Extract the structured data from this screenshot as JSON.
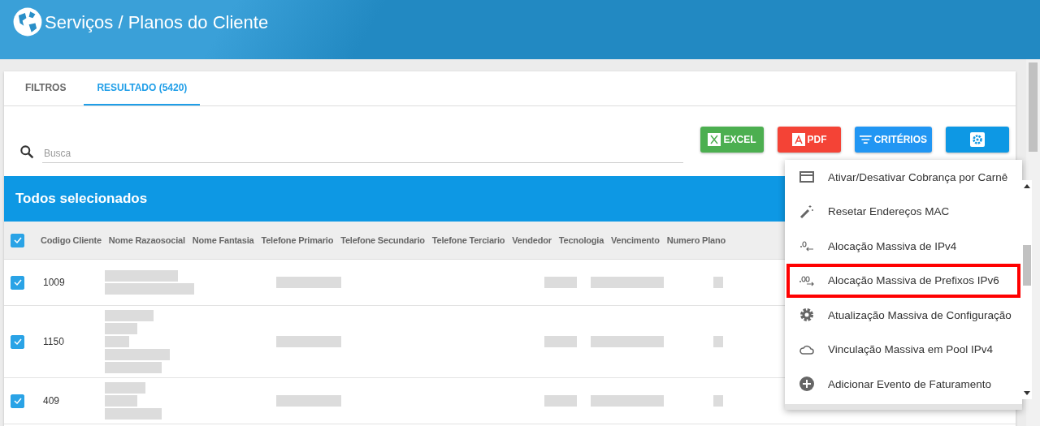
{
  "header": {
    "title": "Serviços / Planos do Cliente"
  },
  "tabs": [
    {
      "label": "FILTROS",
      "selected": false
    },
    {
      "label": "RESULTADO (5420)",
      "selected": true
    }
  ],
  "search": {
    "placeholder": "Busca"
  },
  "buttons": [
    {
      "kind": "excel",
      "label": "EXCEL"
    },
    {
      "kind": "pdf",
      "label": "PDF"
    },
    {
      "kind": "criteria",
      "label": "CRITÉRIOS"
    },
    {
      "kind": "settings"
    }
  ],
  "selection_bar": {
    "title": "Todos selecionados"
  },
  "table": {
    "all_checked": true,
    "columns": [
      "Codigo Cliente",
      "Nome Razaosocial",
      "Nome Fantasia",
      "Telefone Primario",
      "Telefone Secundario",
      "Telefone Terciario",
      "Vendedor",
      "Tecnologia",
      "Vencimento",
      "Numero Plano"
    ],
    "rows": [
      {
        "checked": true,
        "code": "1009"
      },
      {
        "checked": true,
        "code": "1150"
      },
      {
        "checked": true,
        "code": "409"
      }
    ]
  },
  "menu": {
    "items": [
      {
        "kind": "card",
        "label": "Ativar/Desativar Cobrança por Carnê",
        "highlighted": false
      },
      {
        "kind": "wand",
        "label": "Resetar Endereços MAC",
        "highlighted": false
      },
      {
        "kind": "ipv4",
        "label": "Alocação Massiva de IPv4",
        "highlighted": false
      },
      {
        "kind": "ipv6",
        "label": "Alocação Massiva de Prefixos IPv6",
        "highlighted": true
      },
      {
        "kind": "gear",
        "label": "Atualização Massiva de Configuração",
        "highlighted": false
      },
      {
        "kind": "cloud",
        "label": "Vinculação Massiva em Pool IPv4",
        "highlighted": false
      },
      {
        "kind": "plus",
        "label": "Adicionar Evento de Faturamento",
        "highlighted": false
      }
    ]
  }
}
